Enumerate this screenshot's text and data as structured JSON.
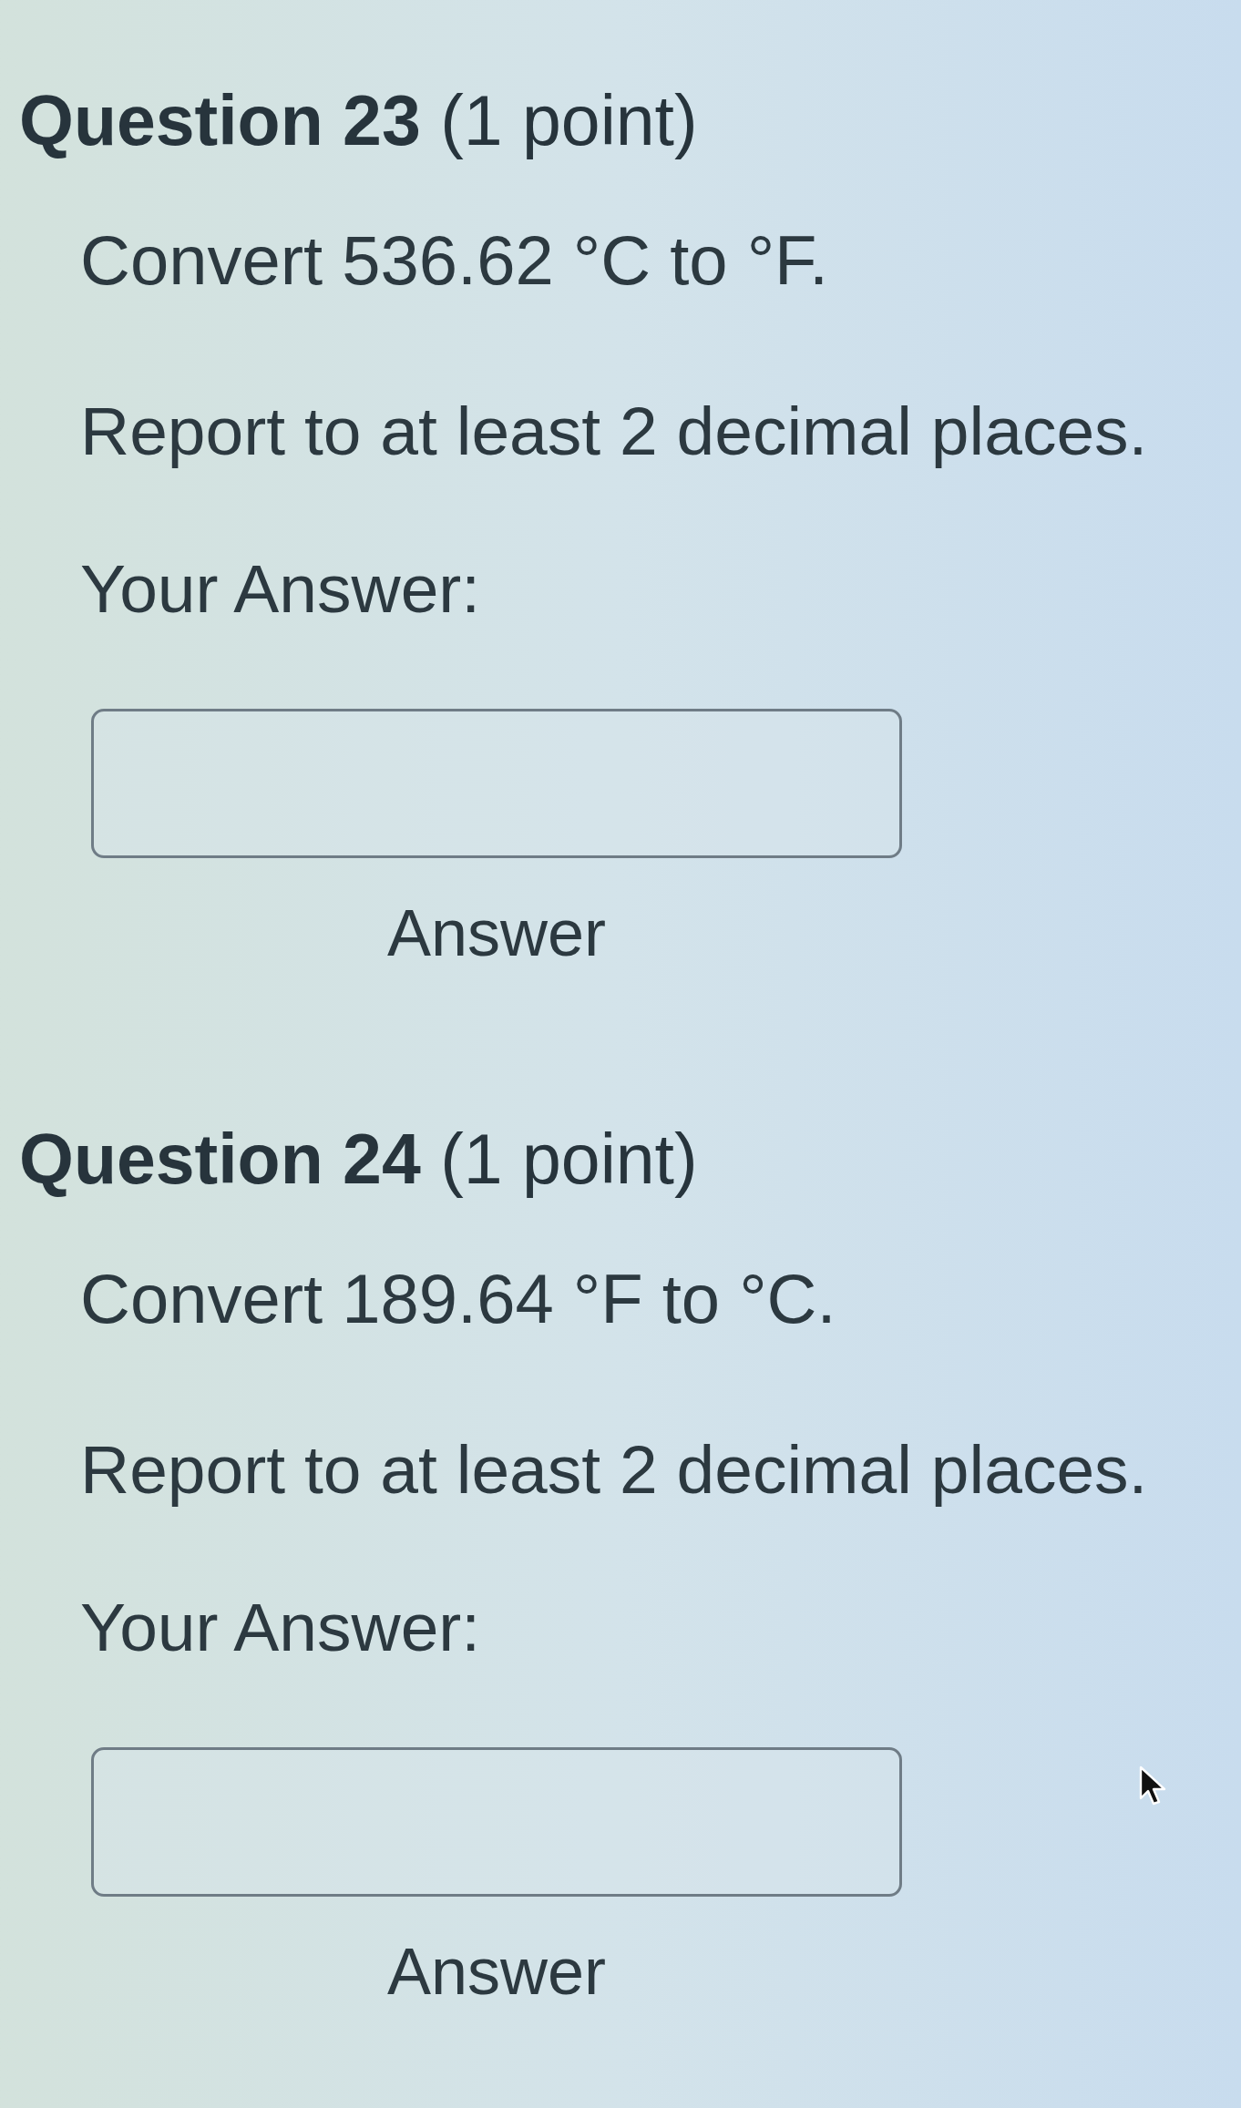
{
  "questions": [
    {
      "heading": "**Question 23** (1 point)",
      "prompt": "Convert 536.62 °C to °F.",
      "instruction": "Report to at least 2 decimal places.",
      "answer_label": "Your Answer:",
      "field_caption": "Answer"
    },
    {
      "heading": "**Question 24** (1 point)",
      "prompt": "Convert 189.64 °F to °C.",
      "instruction": "Report to at least 2 decimal places.",
      "answer_label": "Your Answer:",
      "field_caption": "Answer"
    }
  ]
}
